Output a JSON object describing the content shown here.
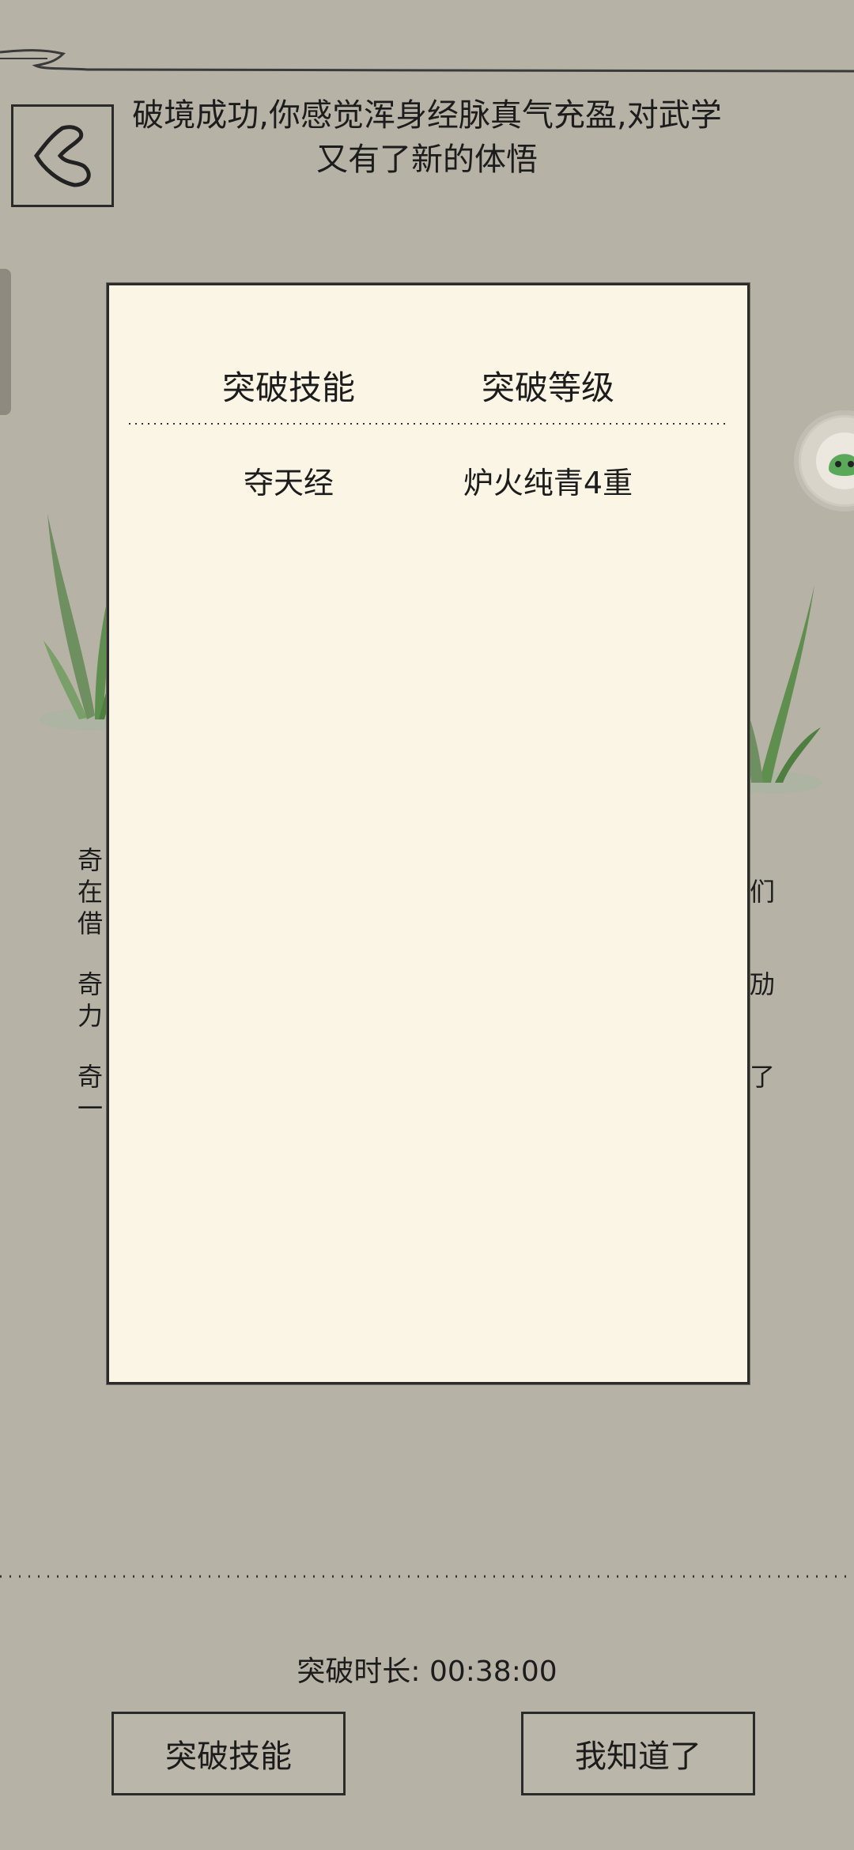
{
  "header": {
    "message": "破境成功,你感觉浑身经脉真气充盈,对武学又有了新的体悟"
  },
  "background_fragments": [
    "奇在借",
    "们",
    "奇力",
    "劢",
    "奇一",
    "了"
  ],
  "modal": {
    "columns": [
      "突破技能",
      "突破等级"
    ],
    "rows": [
      {
        "skill": "夺天经",
        "level": "炉火纯青4重"
      }
    ]
  },
  "footer": {
    "duration_label": "突破时长:",
    "duration_value": "00:38:00",
    "button_left": "突破技能",
    "button_right": "我知道了"
  },
  "colors": {
    "background": "#b7b2a6",
    "modal_background": "#fbf5e5",
    "text": "#1c1c1c",
    "grass": "#5f8f4e"
  },
  "icons": {
    "back": "back-chevron-icon",
    "floating": "spirit-face-icon"
  }
}
